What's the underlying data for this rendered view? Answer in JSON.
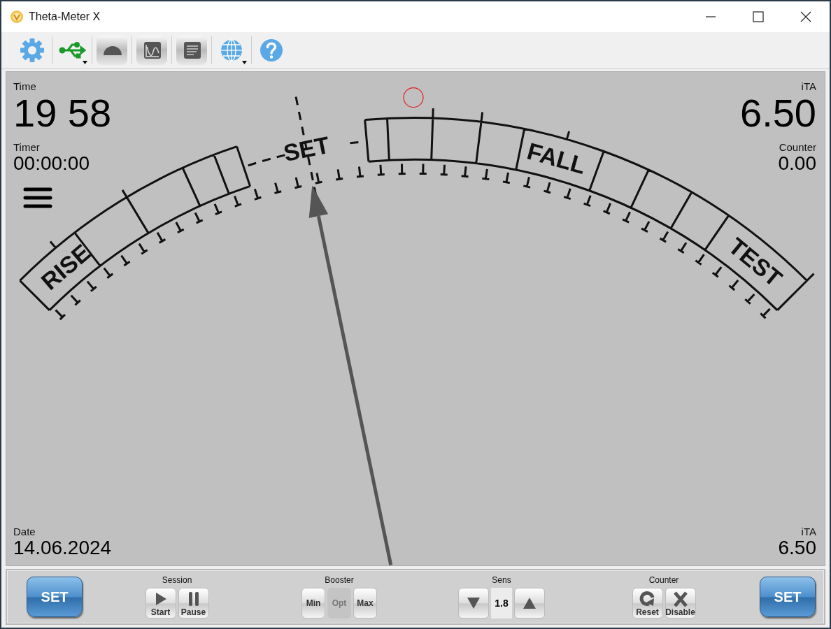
{
  "window": {
    "title": "Theta-Meter X"
  },
  "toolbar": [
    {
      "kind": "settings",
      "dropdown": false
    },
    {
      "kind": "usb",
      "dropdown": true
    },
    {
      "kind": "gauge",
      "dropdown": false
    },
    {
      "kind": "wave",
      "dropdown": false
    },
    {
      "kind": "list",
      "dropdown": false
    },
    {
      "kind": "globe",
      "dropdown": true
    },
    {
      "kind": "help",
      "dropdown": false
    }
  ],
  "readouts": {
    "time": {
      "label": "Time",
      "value": "19 58"
    },
    "timer": {
      "label": "Timer",
      "value": "00:00:00"
    },
    "date": {
      "label": "Date",
      "value": "14.06.2024"
    },
    "ita_top": {
      "label": "iTA",
      "value": "6.50"
    },
    "counter": {
      "label": "Counter",
      "value": "0.00"
    },
    "ita_bottom": {
      "label": "iTA",
      "value": "6.50"
    }
  },
  "dial": {
    "labels": [
      {
        "kind": "rise",
        "text": "RISE"
      },
      {
        "kind": "set",
        "text": "SET"
      },
      {
        "kind": "fall",
        "text": "FALL"
      },
      {
        "kind": "test",
        "text": "TEST"
      }
    ],
    "level": 0.37
  },
  "controls": {
    "set_left": "SET",
    "session": {
      "label": "Session",
      "buttons": [
        {
          "kind": "start",
          "label": "Start"
        },
        {
          "kind": "pause",
          "label": "Pause"
        }
      ]
    },
    "booster": {
      "label": "Booster",
      "options": [
        {
          "label": "Min",
          "selected": false
        },
        {
          "label": "Opt",
          "selected": true
        },
        {
          "label": "Max",
          "selected": false
        }
      ]
    },
    "sens": {
      "label": "Sens",
      "value": "1.8"
    },
    "counter": {
      "label": "Counter",
      "buttons": [
        {
          "kind": "reset",
          "label": "Reset"
        },
        {
          "kind": "disable",
          "label": "Disable"
        }
      ]
    },
    "set_right": "SET"
  }
}
